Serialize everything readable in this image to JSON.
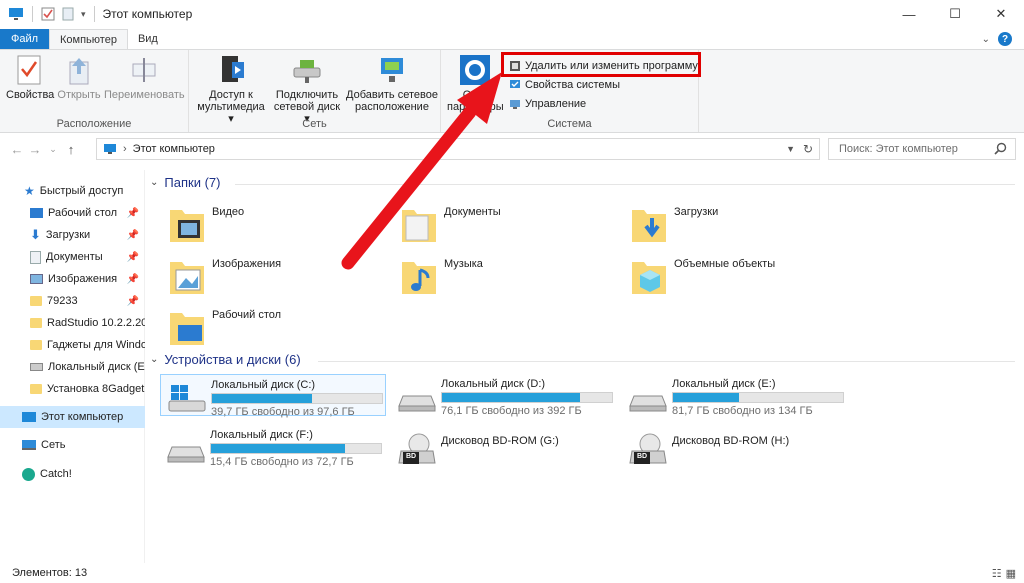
{
  "window": {
    "title": "Этот компьютер",
    "controls": {
      "minimize": "—",
      "maximize": "☐",
      "close": "✕"
    }
  },
  "tabs": [
    {
      "label": "Файл"
    },
    {
      "label": "Компьютер"
    },
    {
      "label": "Вид"
    }
  ],
  "ribbon": {
    "location_group": {
      "label": "Расположение",
      "buttons": [
        {
          "label": "Свойства"
        },
        {
          "label": "Открыть"
        },
        {
          "label": "Переименовать"
        }
      ]
    },
    "network_group": {
      "label": "Сеть",
      "buttons": [
        {
          "line1": "Доступ к",
          "line2": "мультимедиа ▾"
        },
        {
          "line1": "Подключить",
          "line2": "сетевой диск ▾"
        },
        {
          "line1": "Добавить сетевое",
          "line2": "расположение"
        }
      ]
    },
    "system_group": {
      "label": "Система",
      "open_params": {
        "line1": "Откр",
        "line2": "параметры"
      },
      "small_buttons": [
        {
          "label": "Удалить или изменить программу"
        },
        {
          "label": "Свойства системы"
        },
        {
          "label": "Управление"
        }
      ]
    }
  },
  "address": {
    "path": "Этот компьютер",
    "search_placeholder": "Поиск: Этот компьютер"
  },
  "nav": {
    "items": [
      {
        "label": "Быстрый доступ"
      },
      {
        "label": "Рабочий стол"
      },
      {
        "label": "Загрузки"
      },
      {
        "label": "Документы"
      },
      {
        "label": "Изображения"
      },
      {
        "label": "79233"
      },
      {
        "label": "RadStudio 10.2.2.20"
      },
      {
        "label": "Гаджеты для Windo"
      },
      {
        "label": "Локальный диск (E"
      },
      {
        "label": "Установка 8Gadget"
      },
      {
        "label": "Этот компьютер"
      },
      {
        "label": "Сеть"
      },
      {
        "label": "Catch!"
      }
    ]
  },
  "folders_section": {
    "header": "Папки (7)",
    "items": [
      {
        "label": "Видео"
      },
      {
        "label": "Документы"
      },
      {
        "label": "Загрузки"
      },
      {
        "label": "Изображения"
      },
      {
        "label": "Музыка"
      },
      {
        "label": "Объемные объекты"
      },
      {
        "label": "Рабочий стол"
      }
    ]
  },
  "drives_section": {
    "header": "Устройства и диски (6)",
    "drives": [
      {
        "name": "Локальный диск (C:)",
        "free": "39,7 ГБ свободно из 97,6 ГБ",
        "used_fraction": 0.59
      },
      {
        "name": "Локальный диск (D:)",
        "free": "76,1 ГБ свободно из 392 ГБ",
        "used_fraction": 0.81
      },
      {
        "name": "Локальный диск (E:)",
        "free": "81,7 ГБ свободно из 134 ГБ",
        "used_fraction": 0.39
      },
      {
        "name": "Локальный диск (F:)",
        "free": "15,4 ГБ свободно из 72,7 ГБ",
        "used_fraction": 0.79
      },
      {
        "name": "Дисковод BD-ROM (G:)"
      },
      {
        "name": "Дисковод BD-ROM (H:)"
      }
    ],
    "bd_badge": "BD"
  },
  "status": {
    "text": "Элементов: 13"
  },
  "colors": {
    "accent": "#1979ca",
    "highlight": "#e00000",
    "drive_fill": "#26a0da"
  }
}
